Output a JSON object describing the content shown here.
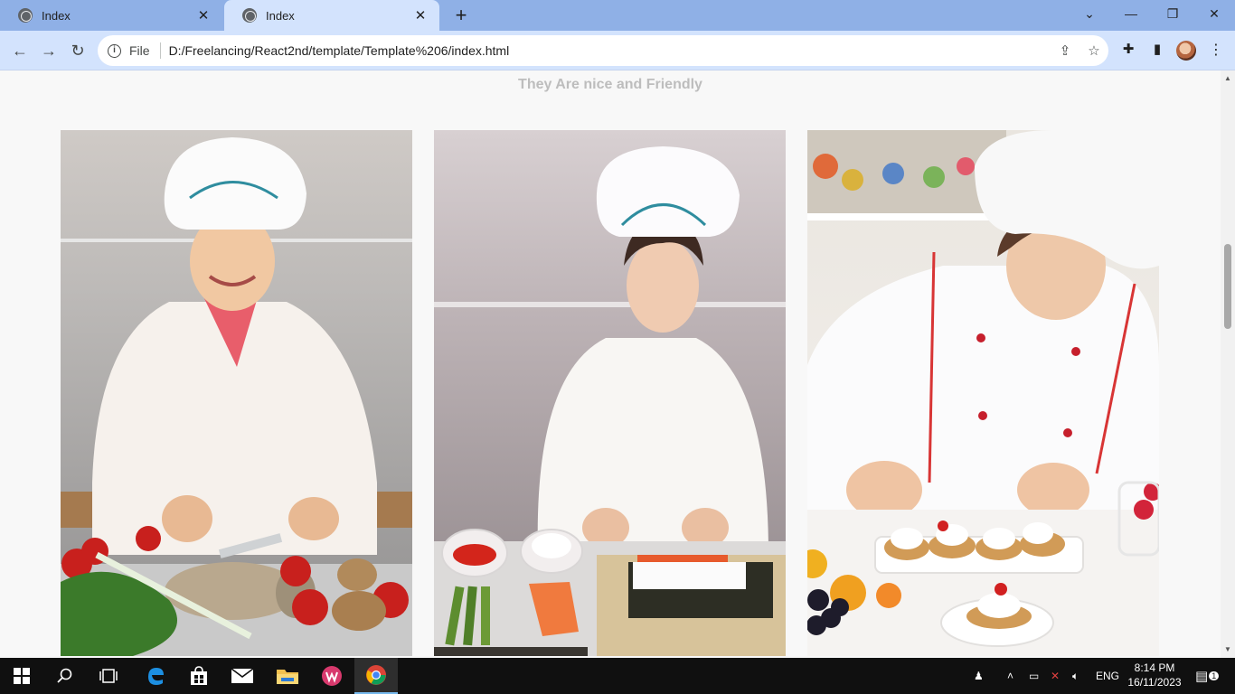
{
  "browser": {
    "tabs": [
      {
        "title": "Index",
        "active": false
      },
      {
        "title": "Index",
        "active": true
      }
    ],
    "new_tab_label": "+",
    "address": {
      "scheme_label": "File",
      "url": "D:/Freelancing/React2nd/template/Template%206/index.html"
    }
  },
  "page": {
    "subtitle": "They Are nice and Friendly",
    "cards": [
      {
        "image": "chef-woman-cutting-fish-vegetables"
      },
      {
        "image": "chef-woman-making-sushi-roll"
      },
      {
        "image": "pastry-chef-decorating-tartlets"
      }
    ]
  },
  "taskbar": {
    "tray_language": "ENG",
    "time": "8:14 PM",
    "date": "16/11/2023",
    "notifications": "1"
  },
  "colors": {
    "tab_strip": "#8fb0e6",
    "toolbar": "#d3e3fd",
    "page_bg": "#f8f8f8",
    "subtitle": "#bdbdbd",
    "taskbar": "#101010"
  }
}
